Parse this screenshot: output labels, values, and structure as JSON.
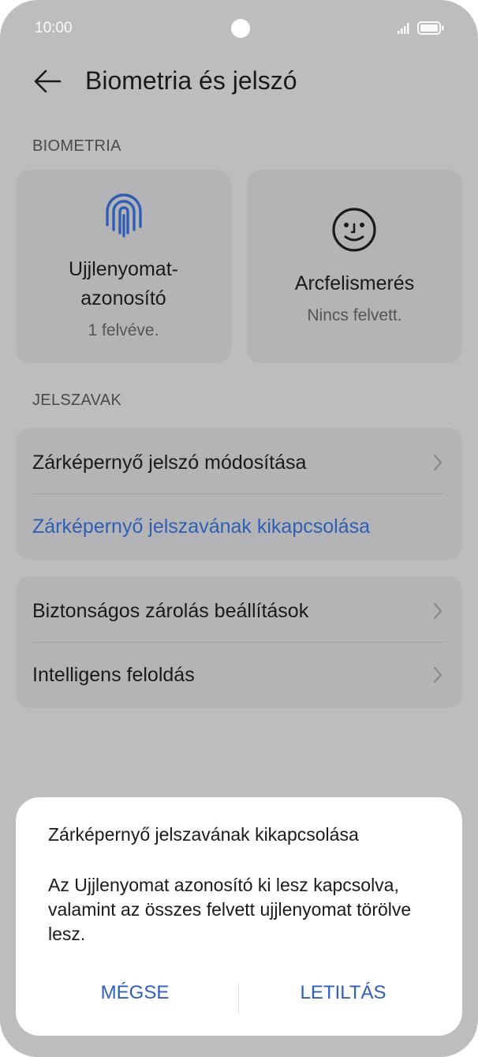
{
  "status_bar": {
    "time": "10:00"
  },
  "header": {
    "title": "Biometria és jelszó"
  },
  "biometrics": {
    "section_label": "BIOMETRIA",
    "fingerprint": {
      "title_line1": "Ujjlenyomat-",
      "title_line2": "azonosító",
      "subtitle": "1 felvéve."
    },
    "face": {
      "title": "Arcfelismerés",
      "subtitle": "Nincs felvett."
    }
  },
  "passwords": {
    "section_label": "JELSZAVAK",
    "items": [
      {
        "label": "Zárképernyő jelszó módosítása"
      },
      {
        "label": "Zárképernyő jelszavának kikapcsolása"
      }
    ]
  },
  "security": {
    "items": [
      {
        "label": "Biztonságos zárolás beállítások"
      },
      {
        "label": "Intelligens feloldás"
      }
    ]
  },
  "dialog": {
    "title": "Zárképernyő jelszavának kikapcsolása",
    "body": "Az Ujjlenyomat azonosító ki lesz kapcsolva, valamint az összes felvett ujjlenyomat törölve lesz.",
    "cancel_label": "MÉGSE",
    "confirm_label": "LETILTÁS"
  },
  "colors": {
    "accent": "#2f5fb5",
    "background": "#bdbdbf",
    "card": "#b4b4b6"
  },
  "icons": [
    "signal-icon",
    "battery-icon",
    "back-arrow-icon",
    "fingerprint-icon",
    "face-icon",
    "chevron-right-icon"
  ]
}
